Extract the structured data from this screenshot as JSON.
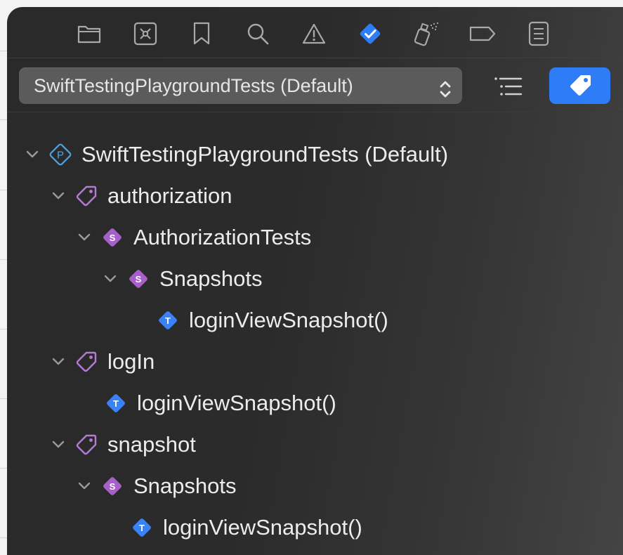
{
  "toolbar": {
    "icons": [
      {
        "name": "project-navigator-icon",
        "active": false
      },
      {
        "name": "source-control-icon",
        "active": false
      },
      {
        "name": "bookmark-icon",
        "active": false
      },
      {
        "name": "find-icon",
        "active": false
      },
      {
        "name": "issue-warning-icon",
        "active": false
      },
      {
        "name": "test-navigator-icon",
        "active": true
      },
      {
        "name": "debug-spray-icon",
        "active": false
      },
      {
        "name": "breakpoint-icon",
        "active": false
      },
      {
        "name": "report-icon",
        "active": false
      }
    ]
  },
  "scheme": {
    "selected": "SwiftTestingPlaygroundTests (Default)",
    "list_view_icon": "list-icon",
    "tag_view_icon": "tag-icon"
  },
  "tree": {
    "root": {
      "label": "SwiftTestingPlaygroundTests (Default)",
      "icon_letter": "P"
    },
    "tag_authorization": {
      "label": "authorization"
    },
    "suite_authorization_tests": {
      "label": "AuthorizationTests",
      "icon_letter": "S"
    },
    "suite_snapshots_1": {
      "label": "Snapshots",
      "icon_letter": "S"
    },
    "test_login_1": {
      "label": "loginViewSnapshot()",
      "icon_letter": "T"
    },
    "tag_login": {
      "label": "logIn"
    },
    "test_login_2": {
      "label": "loginViewSnapshot()",
      "icon_letter": "T"
    },
    "tag_snapshot": {
      "label": "snapshot"
    },
    "suite_snapshots_2": {
      "label": "Snapshots",
      "icon_letter": "S"
    },
    "test_login_3": {
      "label": "loginViewSnapshot()",
      "icon_letter": "T"
    }
  },
  "colors": {
    "accent_blue": "#2f7df6",
    "tag_purple": "#b57ad6",
    "suite_purple": "#a760c9",
    "test_blue": "#3a82f7",
    "project_blue": "#4ea4e0"
  }
}
